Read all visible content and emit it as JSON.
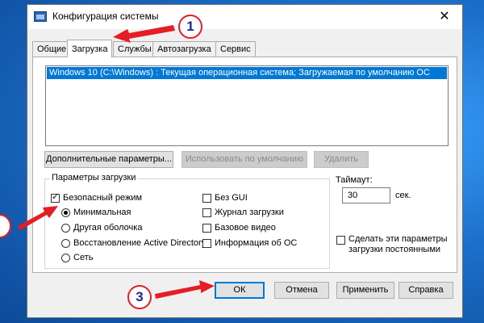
{
  "window": {
    "title": "Конфигурация системы",
    "close_glyph": "✕"
  },
  "tabs": [
    {
      "label": "Общие",
      "active": false
    },
    {
      "label": "Загрузка",
      "active": true
    },
    {
      "label": "Службы",
      "active": false
    },
    {
      "label": "Автозагрузка",
      "active": false
    },
    {
      "label": "Сервис",
      "active": false
    }
  ],
  "boot_list": {
    "selected_item": "Windows 10 (C:\\Windows) : Текущая операционная система; Загружаемая по умолчанию ОС"
  },
  "list_buttons": {
    "advanced": "Дополнительные параметры...",
    "set_default": "Использовать по умолчанию",
    "delete": "Удалить"
  },
  "boot_options": {
    "label": "Параметры загрузки",
    "safe_mode": {
      "label": "Безопасный режим",
      "checked": true
    },
    "radios": [
      {
        "label": "Минимальная",
        "selected": true
      },
      {
        "label": "Другая оболочка",
        "selected": false
      },
      {
        "label": "Восстановление Active Directory",
        "selected": false
      },
      {
        "label": "Сеть",
        "selected": false
      }
    ],
    "checks": [
      {
        "label": "Без GUI",
        "checked": false
      },
      {
        "label": "Журнал загрузки",
        "checked": false
      },
      {
        "label": "Базовое видео",
        "checked": false
      },
      {
        "label": "Информация  об ОС",
        "checked": false
      }
    ]
  },
  "timeout": {
    "label": "Таймаут:",
    "value": "30",
    "unit": "сек."
  },
  "permanent": {
    "label_line1": "Сделать эти параметры",
    "label_line2": "загрузки постоянными",
    "checked": false
  },
  "footer": {
    "ok": "ОК",
    "cancel": "Отмена",
    "apply": "Применить",
    "help": "Справка"
  },
  "annotations": {
    "step1": "1",
    "step3": "3",
    "color_marker": "#e31e24",
    "color_digit": "#1a2a8a"
  }
}
